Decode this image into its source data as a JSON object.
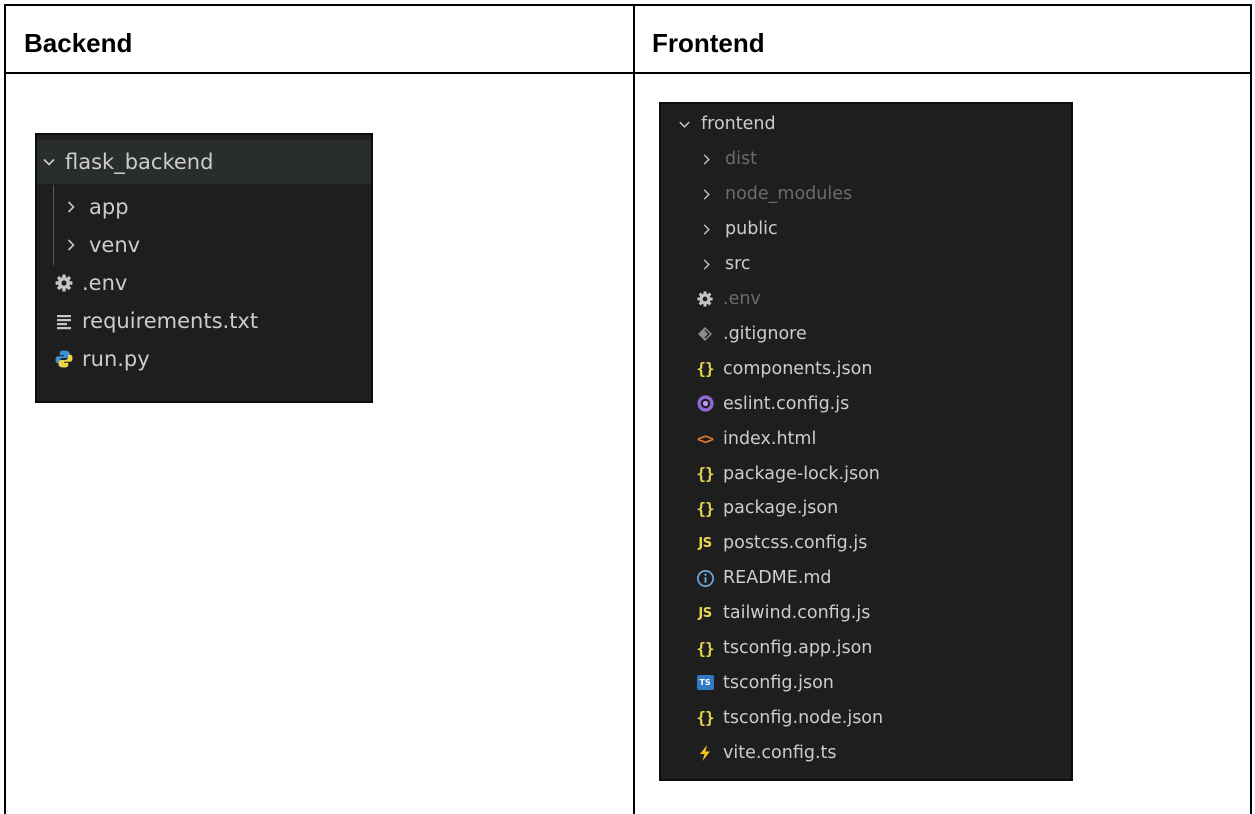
{
  "table": {
    "headers": [
      "Backend",
      "Frontend"
    ]
  },
  "backend": {
    "root": "flask_backend",
    "items": [
      {
        "label": "app",
        "type": "folder",
        "icon": "chevron-right-icon"
      },
      {
        "label": "venv",
        "type": "folder",
        "icon": "chevron-right-icon"
      },
      {
        "label": ".env",
        "type": "file",
        "icon": "gear-icon"
      },
      {
        "label": "requirements.txt",
        "type": "file",
        "icon": "text-lines-icon"
      },
      {
        "label": "run.py",
        "type": "file",
        "icon": "python-icon"
      }
    ]
  },
  "frontend": {
    "root": "frontend",
    "items": [
      {
        "label": "dist",
        "type": "folder",
        "dim": true,
        "icon": "chevron-right-icon"
      },
      {
        "label": "node_modules",
        "type": "folder",
        "dim": true,
        "icon": "chevron-right-icon"
      },
      {
        "label": "public",
        "type": "folder",
        "icon": "chevron-right-icon"
      },
      {
        "label": "src",
        "type": "folder",
        "icon": "chevron-right-icon"
      },
      {
        "label": ".env",
        "type": "file",
        "dim": true,
        "icon": "gear-icon"
      },
      {
        "label": ".gitignore",
        "type": "file",
        "icon": "git-diamond-icon"
      },
      {
        "label": "components.json",
        "type": "file",
        "icon": "json-braces-icon"
      },
      {
        "label": "eslint.config.js",
        "type": "file",
        "icon": "eslint-icon"
      },
      {
        "label": "index.html",
        "type": "file",
        "icon": "html-brackets-icon"
      },
      {
        "label": "package-lock.json",
        "type": "file",
        "icon": "json-braces-icon"
      },
      {
        "label": "package.json",
        "type": "file",
        "icon": "json-braces-icon"
      },
      {
        "label": "postcss.config.js",
        "type": "file",
        "icon": "js-icon"
      },
      {
        "label": "README.md",
        "type": "file",
        "icon": "info-icon"
      },
      {
        "label": "tailwind.config.js",
        "type": "file",
        "icon": "js-icon"
      },
      {
        "label": "tsconfig.app.json",
        "type": "file",
        "icon": "json-braces-icon"
      },
      {
        "label": "tsconfig.json",
        "type": "file",
        "icon": "ts-icon"
      },
      {
        "label": "tsconfig.node.json",
        "type": "file",
        "icon": "json-braces-icon"
      },
      {
        "label": "vite.config.ts",
        "type": "file",
        "icon": "vite-bolt-icon"
      }
    ]
  },
  "icon_text": {
    "json": "{}",
    "js": "JS",
    "html": "<>",
    "ts": "TS"
  },
  "colors": {
    "explorer_bg": "#1e1e1e",
    "root_row_bg": "#2a2d2e",
    "label": "#cccccc",
    "dim_label": "#6b6b6b",
    "json_icon": "#e8d44d",
    "js_icon": "#e8d44d",
    "html_icon": "#e37933",
    "ts_icon": "#3178c6",
    "eslint_icon": "#8f6bd8",
    "python_icon": "#3b8fd4",
    "gear_icon": "#c5c5c5"
  }
}
